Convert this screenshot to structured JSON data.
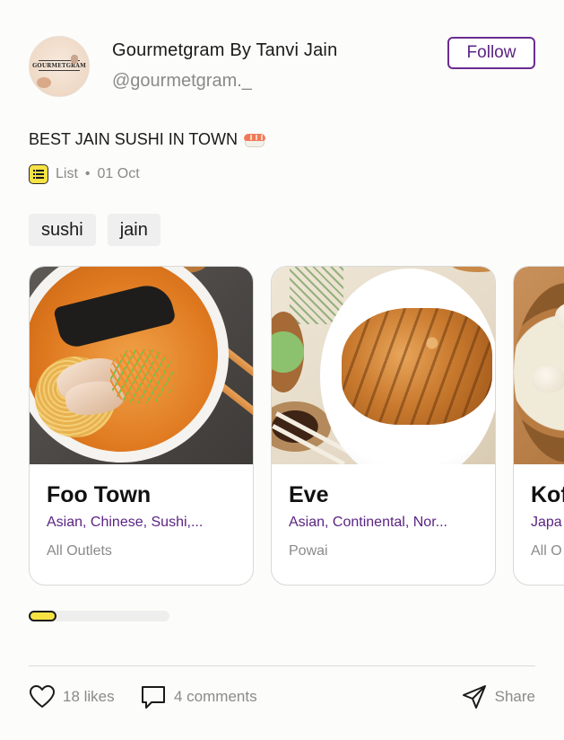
{
  "header": {
    "avatar_logo_text": "GOURMETGRAM",
    "name": "Gourmetgram By Tanvi Jain",
    "handle": "@gourmetgram._",
    "follow_label": "Follow"
  },
  "post": {
    "title": "BEST JAIN SUSHI IN TOWN",
    "title_icon": "sushi-emoji",
    "type_icon": "list-icon",
    "type_label": "List",
    "date": "01 Oct",
    "tags": [
      "sushi",
      "jain"
    ]
  },
  "cards": [
    {
      "title": "Foo Town",
      "cuisine": "Asian, Chinese, Sushi,...",
      "location": "All Outlets"
    },
    {
      "title": "Eve",
      "cuisine": "Asian, Continental, Nor...",
      "location": "Powai"
    },
    {
      "title": "Kof",
      "cuisine": "Japa",
      "location": "All O"
    }
  ],
  "progress": {
    "fraction": 0.2
  },
  "footer": {
    "likes": "18 likes",
    "comments": "4 comments",
    "share": "Share"
  },
  "colors": {
    "accent_purple": "#5b2483",
    "highlight_yellow": "#f7e244",
    "background": "#fcfcfa"
  }
}
